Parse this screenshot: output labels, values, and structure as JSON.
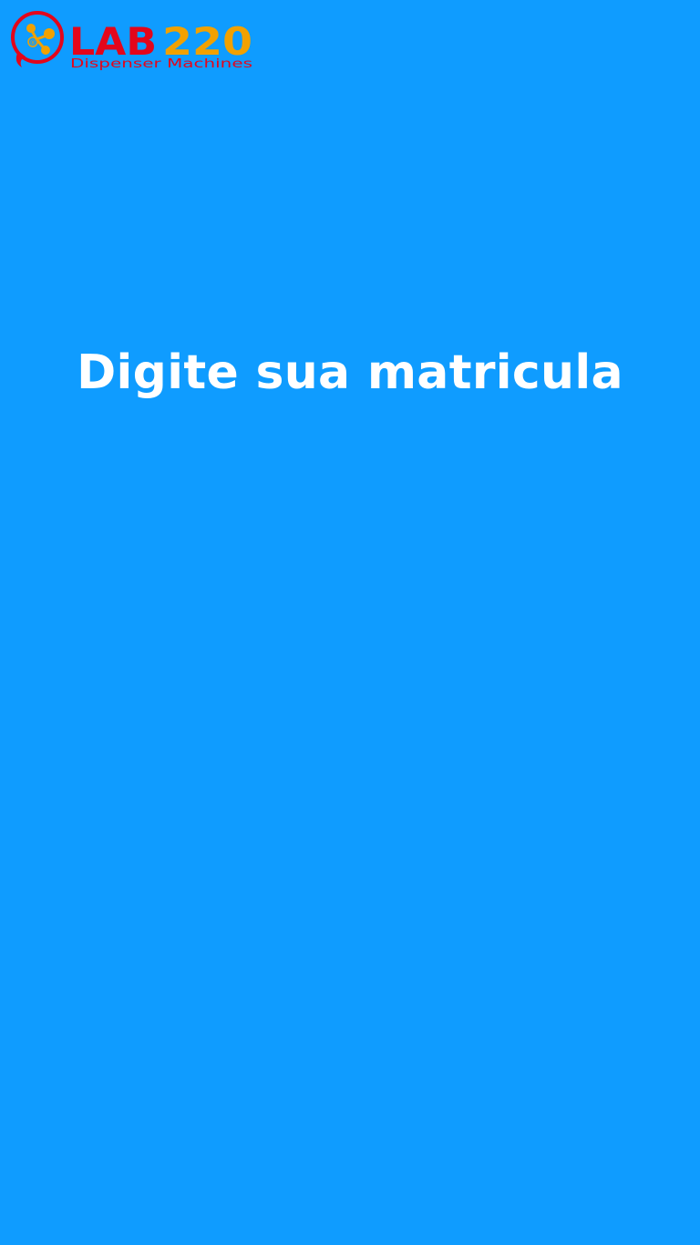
{
  "brand": {
    "logo_icon": "molecule-icon",
    "logo_lab": "LAB",
    "logo_number": "220",
    "logo_tagline": "Dispenser Machines",
    "registered_mark": "®",
    "colors": {
      "red": "#e3061b",
      "orange": "#f2a100"
    }
  },
  "screen": {
    "background_color": "#0f9cff",
    "prompt": "Digite sua matricula"
  }
}
